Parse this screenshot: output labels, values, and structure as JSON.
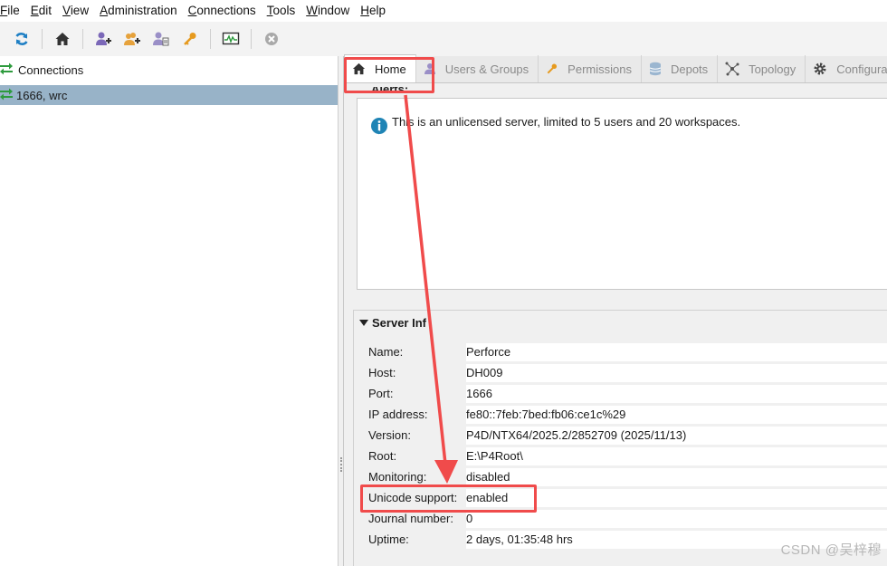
{
  "menu": {
    "items": [
      {
        "label": "File",
        "mnemonic": "F"
      },
      {
        "label": "Edit",
        "mnemonic": "E"
      },
      {
        "label": "View",
        "mnemonic": "V"
      },
      {
        "label": "Administration",
        "mnemonic": "A"
      },
      {
        "label": "Connections",
        "mnemonic": "C"
      },
      {
        "label": "Tools",
        "mnemonic": "T"
      },
      {
        "label": "Window",
        "mnemonic": "W"
      },
      {
        "label": "Help",
        "mnemonic": "H"
      }
    ]
  },
  "toolbar": {
    "icons": [
      "refresh-icon",
      "home-icon",
      "add-user-icon",
      "add-group-icon",
      "user-props-icon",
      "key-icon",
      "monitor-icon",
      "stop-icon"
    ]
  },
  "left": {
    "header": "Connections",
    "connection": "1666,  wrc"
  },
  "tabs": [
    {
      "label": "Home",
      "icon": "home-icon",
      "active": true
    },
    {
      "label": "Users & Groups",
      "icon": "users-icon",
      "active": false
    },
    {
      "label": "Permissions",
      "icon": "key-icon",
      "active": false
    },
    {
      "label": "Depots",
      "icon": "depot-icon",
      "active": false
    },
    {
      "label": "Topology",
      "icon": "topology-icon",
      "active": false
    },
    {
      "label": "Configura",
      "icon": "gear-icon",
      "active": false
    }
  ],
  "alerts": {
    "title": "Alerts:",
    "message": "This is an unlicensed server, limited to 5 users and 20 workspaces."
  },
  "server_info": {
    "title": "Server Inf",
    "rows": [
      {
        "label": "Name:",
        "value": "Perforce"
      },
      {
        "label": "Host:",
        "value": "DH009"
      },
      {
        "label": "Port:",
        "value": "1666"
      },
      {
        "label": "IP address:",
        "value": "fe80::7feb:7bed:fb06:ce1c%29"
      },
      {
        "label": "Version:",
        "value": "P4D/NTX64/2025.2/2852709 (2025/11/13)"
      },
      {
        "label": "Root:",
        "value": "E:\\P4Root\\"
      },
      {
        "label": "Monitoring:",
        "value": "disabled"
      },
      {
        "label": "Unicode support:",
        "value": "enabled"
      },
      {
        "label": "Journal number:",
        "value": "0"
      },
      {
        "label": "Uptime:",
        "value": "2 days, 01:35:48 hrs"
      }
    ]
  },
  "colors": {
    "annotation_red": "#f04b4b",
    "selection_blue": "#98b3c8",
    "connection_green": "#2e9b3e"
  },
  "watermark": "CSDN @吴梓穆"
}
